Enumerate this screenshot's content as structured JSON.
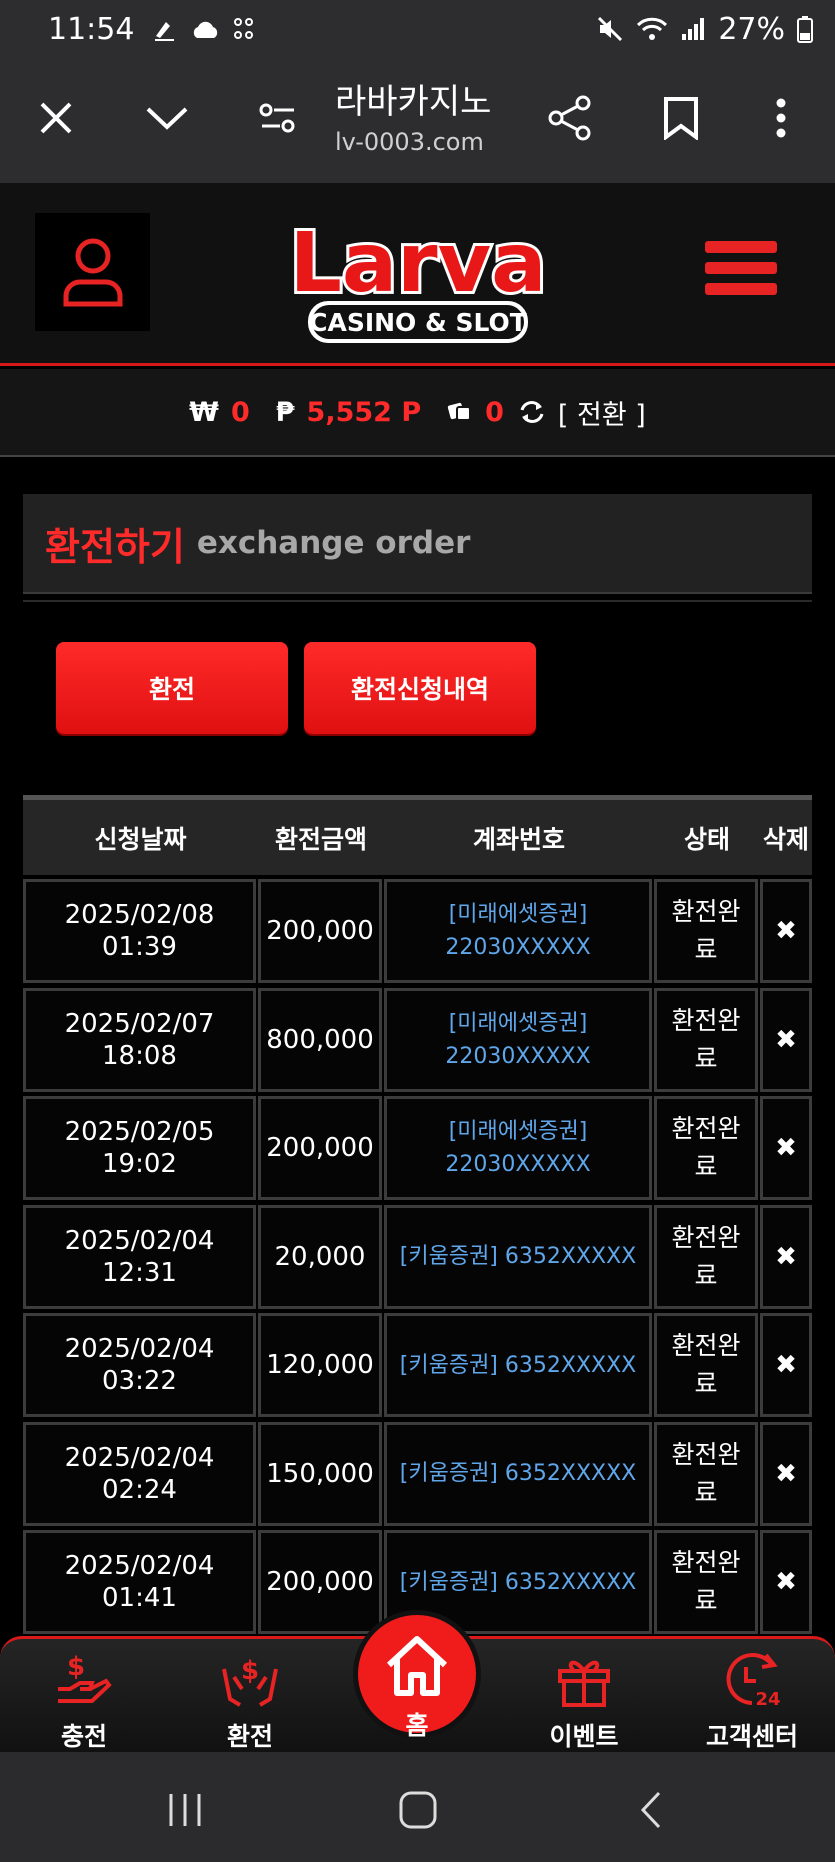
{
  "status_bar": {
    "time": "11:54",
    "battery": "27%",
    "icons": [
      "signature-icon",
      "cloud-icon",
      "dice-icon",
      "mute-icon",
      "wifi-icon",
      "signal-icon",
      "battery-icon"
    ]
  },
  "browser": {
    "title": "라바카지노",
    "url": "lv-0003.com",
    "icons": [
      "close-icon",
      "chevron-down-icon",
      "tune-icon",
      "share-icon",
      "bookmark-icon",
      "more-vert-icon"
    ]
  },
  "header": {
    "logo_text": "Larva",
    "logo_sub": "CASINO & SLOT"
  },
  "balance": {
    "won_symbol": "₩",
    "won_value": "0",
    "point_symbol": "₱",
    "point_value": "5,552 P",
    "casino_value": "0",
    "switch_label": "[ 전환 ]"
  },
  "section": {
    "title_ko": "환전하기",
    "title_en": "exchange order"
  },
  "buttons": {
    "exchange": "환전",
    "history": "환전신청내역"
  },
  "table": {
    "headers": [
      "신청날짜",
      "환전금액",
      "계좌번호",
      "상태",
      "삭제"
    ],
    "rows": [
      {
        "date": "2025/02/08",
        "time": "01:39",
        "amount": "200,000",
        "acct1": "[미래에셋증권]",
        "acct2": "22030XXXXX",
        "status1": "환전완",
        "status2": "료",
        "del": "✖"
      },
      {
        "date": "2025/02/07",
        "time": "18:08",
        "amount": "800,000",
        "acct1": "[미래에셋증권]",
        "acct2": "22030XXXXX",
        "status1": "환전완",
        "status2": "료",
        "del": "✖"
      },
      {
        "date": "2025/02/05",
        "time": "19:02",
        "amount": "200,000",
        "acct1": "[미래에셋증권]",
        "acct2": "22030XXXXX",
        "status1": "환전완",
        "status2": "료",
        "del": "✖"
      },
      {
        "date": "2025/02/04",
        "time": "12:31",
        "amount": "20,000",
        "acct1": "[키움증권] 6352XXXXX",
        "acct2": "",
        "status1": "환전완",
        "status2": "료",
        "del": "✖"
      },
      {
        "date": "2025/02/04",
        "time": "03:22",
        "amount": "120,000",
        "acct1": "[키움증권] 6352XXXXX",
        "acct2": "",
        "status1": "환전완",
        "status2": "료",
        "del": "✖"
      },
      {
        "date": "2025/02/04",
        "time": "02:24",
        "amount": "150,000",
        "acct1": "[키움증권] 6352XXXXX",
        "acct2": "",
        "status1": "환전완",
        "status2": "료",
        "del": "✖"
      },
      {
        "date": "2025/02/04",
        "time": "01:41",
        "amount": "200,000",
        "acct1": "[키움증권] 6352XXXXX",
        "acct2": "",
        "status1": "환전완",
        "status2": "료",
        "del": "✖"
      }
    ]
  },
  "bottom_nav": {
    "deposit": "충전",
    "exchange": "환전",
    "home": "홈",
    "event": "이벤트",
    "support": "고객센터",
    "support_badge": "24"
  },
  "colors": {
    "accent": "#ff2b2b",
    "link": "#5fa6ea",
    "background": "#000000"
  }
}
